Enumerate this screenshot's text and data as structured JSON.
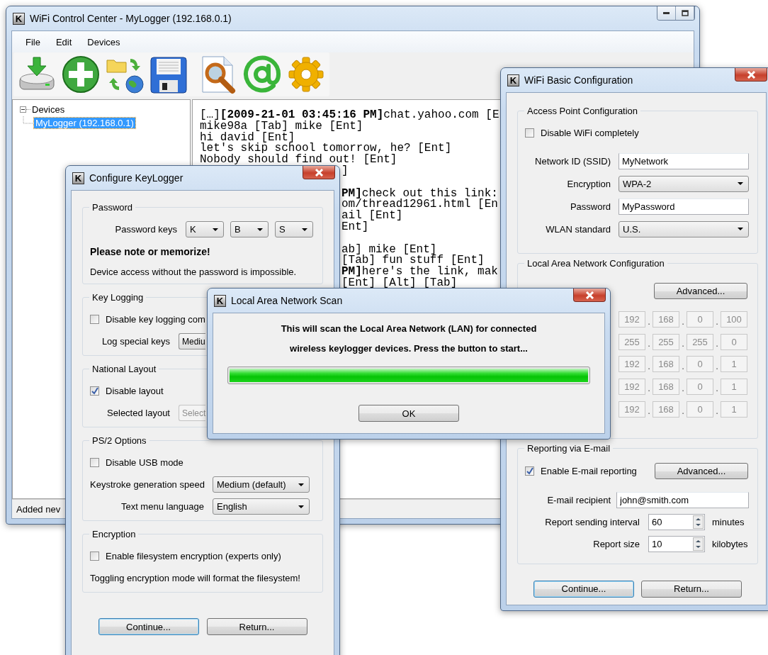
{
  "main_window": {
    "icon_letter": "K",
    "title": "WiFi Control Center - MyLogger (192.168.0.1)",
    "menu": [
      "File",
      "Edit",
      "Devices"
    ],
    "tree": {
      "label": "Devices",
      "expanded": true,
      "children": [
        {
          "label": "MyLogger (192.168.0.1)",
          "selected": true
        }
      ]
    },
    "log": {
      "lines": [
        "[…]**[2009-21-01 03:45:16 PM]**chat.yahoo.com [E",
        "mike98a [Tab] mike [Ent]",
        "hi david [Ent]",
        "let's skip school tomorrow, he? [Ent]",
        "Nobody should find out! [Ent]"
      ],
      "lines_beside_dialog": [
        {
          "text": "]",
          "gap_before": false
        },
        {
          "text": "**PM]**check out this link:",
          "gap_before": true
        },
        {
          "text": "om/thread12961.html [En",
          "gap_before": false
        },
        {
          "text": "ail [Ent]",
          "gap_before": false
        },
        {
          "text": "Ent]",
          "gap_before": false
        },
        {
          "text": "ab] mike [Ent]",
          "gap_before": true
        },
        {
          "text": "[Tab] fun stuff [Ent]",
          "gap_before": false
        },
        {
          "text": "**PM]**here's the link, mak",
          "gap_before": false
        },
        {
          "text": "[Ent] [Alt] [Tab]",
          "gap_before": false
        }
      ]
    },
    "status_bar": "Added nev"
  },
  "configure_keylogger": {
    "icon_letter": "K",
    "title": "Configure KeyLogger",
    "password": {
      "legend": "Password",
      "label": "Password keys",
      "keys": [
        "K",
        "B",
        "S"
      ],
      "note": "Please note or memorize!",
      "hint": "Device access without the password is impossible."
    },
    "key_logging": {
      "legend": "Key Logging",
      "checkbox": {
        "label": "Disable key logging com",
        "checked": false
      },
      "special_label": "Log special keys",
      "special_value": "Mediu"
    },
    "national_layout": {
      "legend": "National Layout",
      "checkbox": {
        "label": "Disable layout",
        "checked": true
      },
      "layout_label": "Selected layout",
      "layout_value": "Select",
      "layout_disabled": true
    },
    "ps2": {
      "legend": "PS/2 Options",
      "checkbox": {
        "label": "Disable USB mode",
        "checked": false
      },
      "fields": [
        {
          "label": "Keystroke generation speed",
          "value": "Medium (default)"
        },
        {
          "label": "Text menu language",
          "value": "English"
        }
      ]
    },
    "encryption": {
      "legend": "Encryption",
      "checkbox": {
        "label": "Enable filesystem encryption (experts only)",
        "checked": false
      },
      "warning": "Toggling encryption mode will format the filesystem!"
    },
    "buttons": [
      {
        "label": "Continue...",
        "default": true
      },
      {
        "label": "Return...",
        "default": false
      }
    ]
  },
  "wifi_config": {
    "icon_letter": "K",
    "title": "WiFi Basic Configuration",
    "access_point": {
      "legend": "Access Point Configuration",
      "checkbox": {
        "label": "Disable WiFi completely",
        "checked": false
      },
      "fields": [
        {
          "kind": "text",
          "label": "Network ID (SSID)",
          "value": "MyNetwork"
        },
        {
          "kind": "select",
          "label": "Encryption",
          "value": "WPA-2"
        },
        {
          "kind": "text",
          "label": "Password",
          "value": "MyPassword"
        },
        {
          "kind": "select",
          "label": "WLAN standard",
          "value": "U.S."
        }
      ]
    },
    "lan": {
      "legend": "Local Area Network Configuration",
      "button": "Advanced...",
      "separator": ".",
      "ip_disabled": true,
      "ip_rows": [
        [
          "192",
          "168",
          "0",
          "100"
        ],
        [
          "255",
          "255",
          "255",
          "0"
        ],
        [
          "192",
          "168",
          "0",
          "1"
        ],
        [
          "192",
          "168",
          "0",
          "1"
        ],
        [
          "192",
          "168",
          "0",
          "1"
        ]
      ]
    },
    "reporting": {
      "legend": "Reporting via E-mail",
      "checkbox": {
        "label": "Enable E-mail reporting",
        "checked": true
      },
      "button": "Advanced...",
      "recipient": {
        "label": "E-mail recipient",
        "value": "john@smith.com"
      },
      "spinners": [
        {
          "label": "Report sending interval",
          "value": "60",
          "unit": "minutes"
        },
        {
          "label": "Report size",
          "value": "10",
          "unit": "kilobytes"
        }
      ]
    },
    "buttons": [
      {
        "label": "Continue...",
        "default": true
      },
      {
        "label": "Return...",
        "default": false
      }
    ]
  },
  "lan_scan": {
    "icon_letter": "K",
    "title": "Local Area Network Scan",
    "message_lines": [
      "This will scan the Local Area Network (LAN) for connected",
      "wireless keylogger devices. Press the button to start..."
    ],
    "progress": {
      "level": 1
    },
    "button": "OK"
  }
}
